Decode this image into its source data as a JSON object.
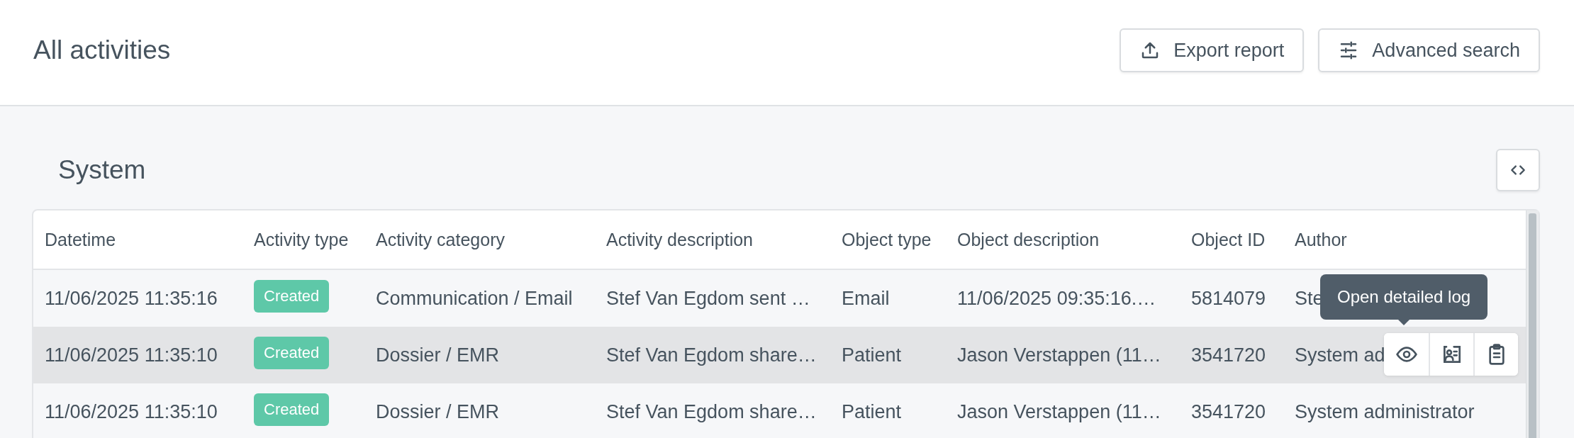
{
  "page": {
    "title": "All activities"
  },
  "header_buttons": [
    {
      "label": "Export report",
      "kind": "export"
    },
    {
      "label": "Advanced search",
      "kind": "filter"
    }
  ],
  "section": {
    "title": "System"
  },
  "table": {
    "columns": [
      "Datetime",
      "Activity type",
      "Activity category",
      "Activity description",
      "Object type",
      "Object description",
      "Object ID",
      "Author"
    ],
    "rows": [
      {
        "datetime": "11/06/2025 11:35:16",
        "activity_type": "Created",
        "activity_category": "Communication / Email",
        "activity_description": "Stef Van Egdom sent …",
        "object_type": "Email",
        "object_description": "11/06/2025 09:35:16.…",
        "object_id": "5814079",
        "author": "Ste",
        "highlighted": false
      },
      {
        "datetime": "11/06/2025 11:35:10",
        "activity_type": "Created",
        "activity_category": "Dossier / EMR",
        "activity_description": "Stef Van Egdom share…",
        "object_type": "Patient",
        "object_description": "Jason Verstappen (11…",
        "object_id": "3541720",
        "author": "System ad",
        "highlighted": true,
        "tooltip": "Open detailed log"
      },
      {
        "datetime": "11/06/2025 11:35:10",
        "activity_type": "Created",
        "activity_category": "Dossier / EMR",
        "activity_description": "Stef Van Egdom share…",
        "object_type": "Patient",
        "object_description": "Jason Verstappen (11…",
        "object_id": "3541720",
        "author": "System administrator",
        "highlighted": false
      }
    ]
  }
}
